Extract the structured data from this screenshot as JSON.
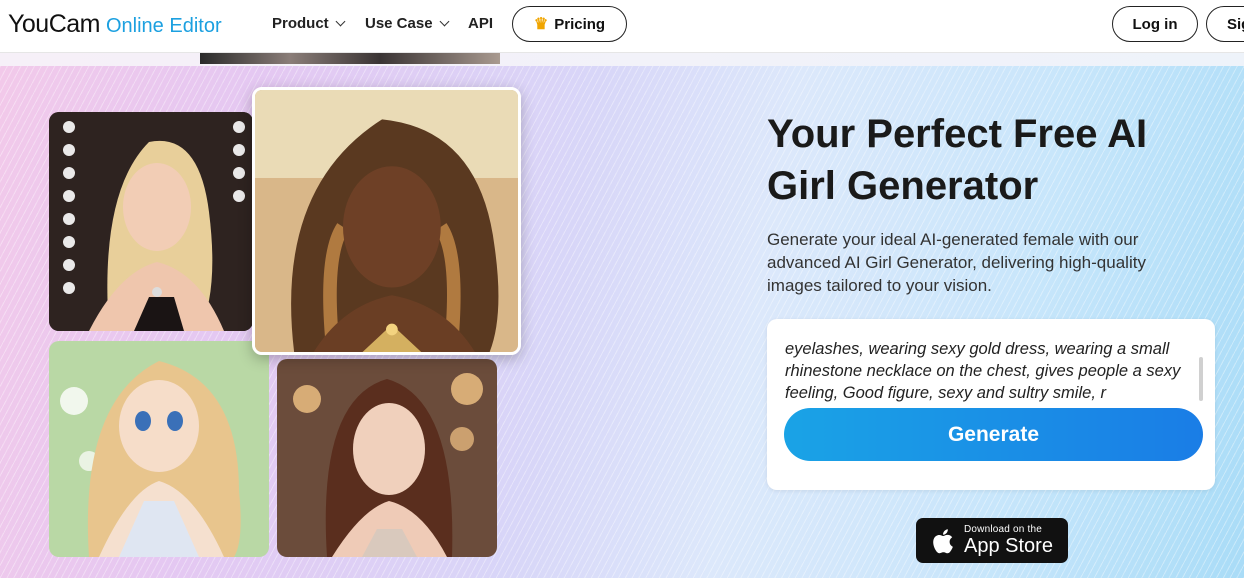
{
  "nav": {
    "logo_main": "YouCam",
    "logo_sub": "Online Editor",
    "product": "Product",
    "use_case": "Use Case",
    "api": "API",
    "pricing": "Pricing",
    "login": "Log in",
    "signup": "Sig"
  },
  "hero": {
    "title": "Your Perfect Free AI Girl Generator",
    "description": "Generate your ideal AI-generated female with our advanced AI Girl Generator, delivering high-quality images tailored to your vision.",
    "prompt_text": "eyelashes, wearing sexy gold dress, wearing a small rhinestone necklace on the chest, gives people a sexy feeling, Good figure, sexy and sultry smile, r",
    "generate_label": "Generate",
    "appstore_small": "Download on the",
    "appstore_big": "App Store"
  },
  "colors": {
    "accent": "#1ca0e0",
    "button_gradient_start": "#1aa3e6",
    "button_gradient_end": "#1a7de6",
    "pricing_crown": "#f0a500"
  }
}
